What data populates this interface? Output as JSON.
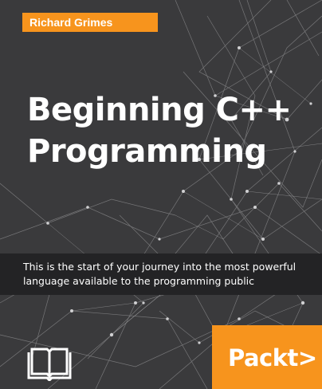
{
  "cover": {
    "author": "Richard Grimes",
    "title_line1": "Beginning C++",
    "title_line2": "Programming",
    "description_line1": "This is the start of your journey into the most powerful",
    "description_line2": "language available to the programming public",
    "publisher": "Packt>",
    "colors": {
      "background": "#3a3a3c",
      "accent_orange": "#f7941d",
      "description_band": "#232325",
      "text": "#ffffff"
    },
    "icons": [
      "network-lines-graphic",
      "open-book-icon"
    ]
  }
}
